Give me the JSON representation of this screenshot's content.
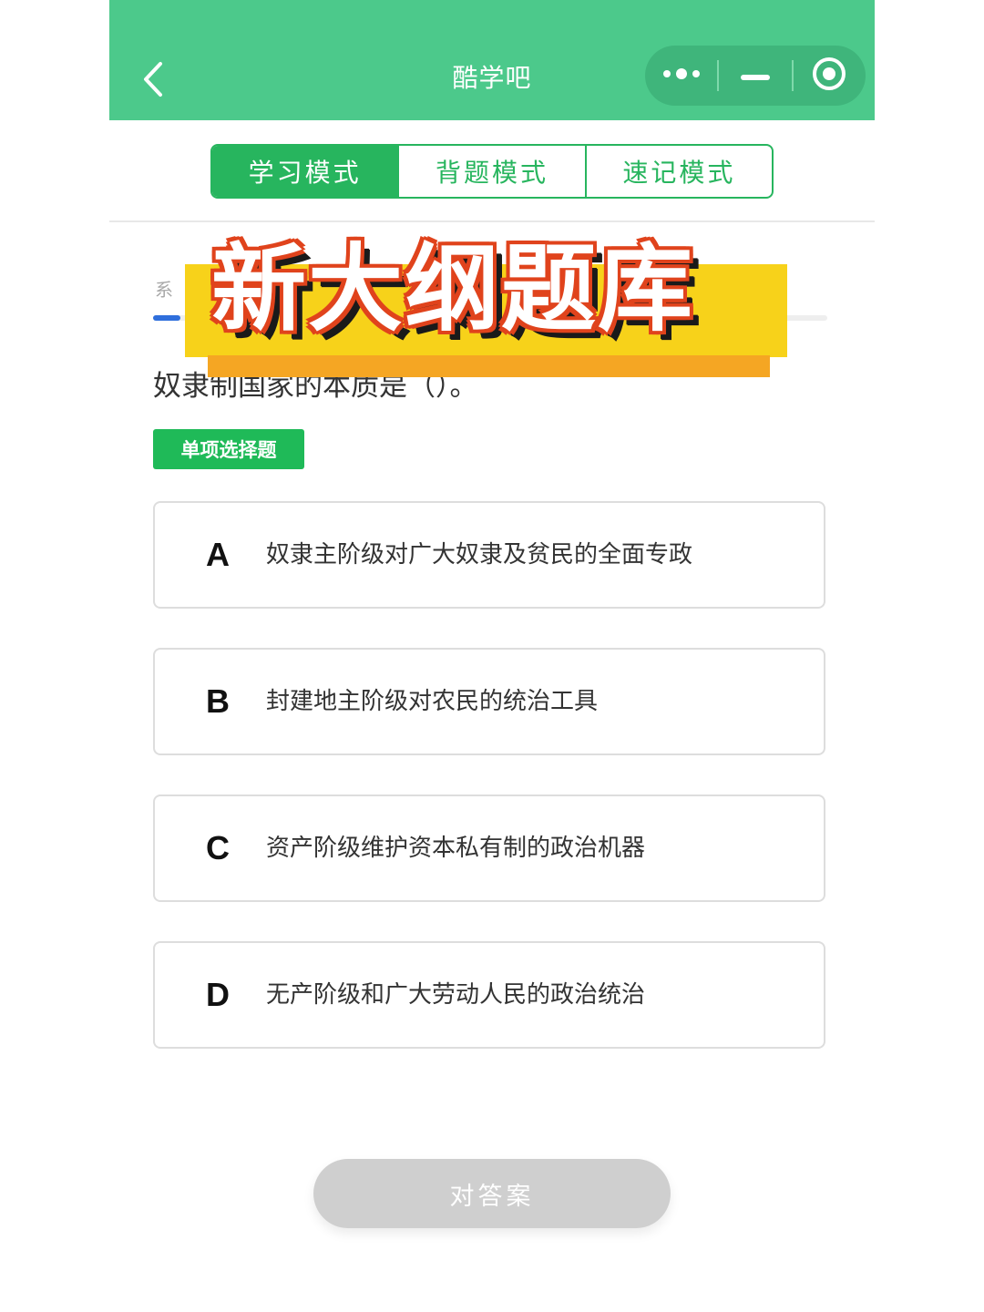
{
  "header": {
    "title": "酷学吧",
    "bg_color": "#4cc98b"
  },
  "capsule": {
    "more_icon": "more-dots-icon",
    "minimize_icon": "minimize-icon",
    "close_icon": "target-close-icon"
  },
  "modes": {
    "items": [
      {
        "label": "学习模式",
        "active": true
      },
      {
        "label": "背题模式",
        "active": false
      },
      {
        "label": "速记模式",
        "active": false
      }
    ],
    "accent": "#27b55e"
  },
  "progress": {
    "label": "系",
    "fraction": 0.04,
    "color": "#2f6fdc"
  },
  "question": {
    "text": "奴隶制国家的本质是（）。",
    "type": "单项选择题"
  },
  "options": [
    {
      "letter": "A",
      "text": "奴隶主阶级对广大奴隶及贫民的全面专政"
    },
    {
      "letter": "B",
      "text": "封建地主阶级对农民的统治工具"
    },
    {
      "letter": "C",
      "text": "资产阶级维护资本私有制的政治机器"
    },
    {
      "letter": "D",
      "text": "无产阶级和广大劳动人民的政治统治"
    }
  ],
  "submit": {
    "label": "对答案"
  },
  "banner": {
    "text": "新大纲题库",
    "colors": {
      "fill": "#ffffff",
      "outline": "#e0431c",
      "band": "#f7d21a",
      "band2": "#f5a623"
    }
  }
}
